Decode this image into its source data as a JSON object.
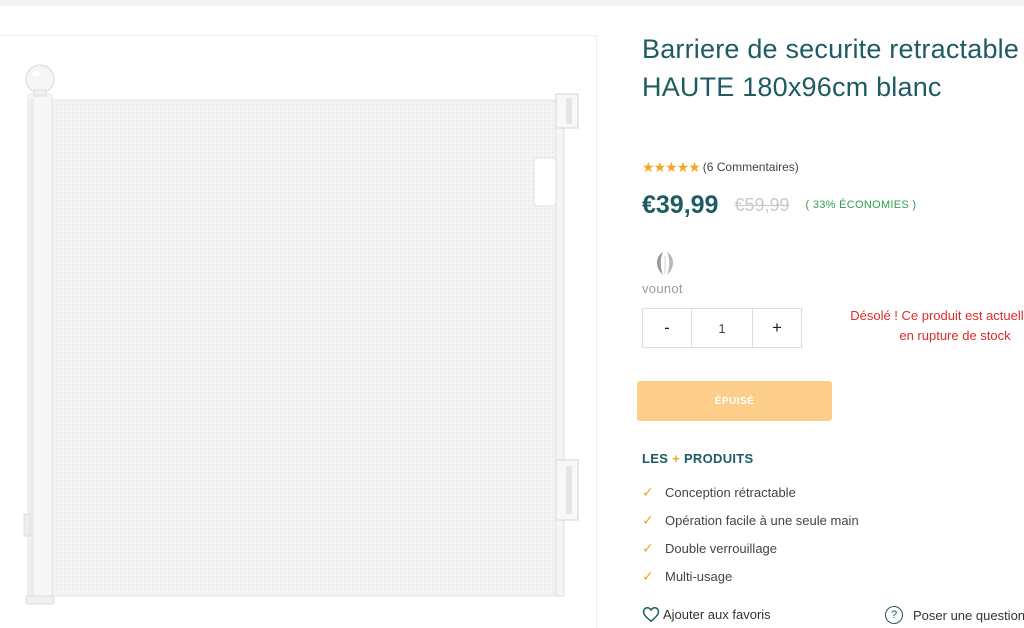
{
  "product": {
    "title": "Barriere de securite retractable HAUTE 180x96cm blanc",
    "image_alt": "Barrière de sécurité rétractable blanche",
    "rating": {
      "stars": 5,
      "reviews_label": "(6 Commentaires)"
    },
    "price": "€39,99",
    "old_price": "€59,99",
    "savings": "( 33% ÉCONOMIES )",
    "brand": "vounot",
    "quantity": {
      "decrement": "-",
      "value": "1",
      "increment": "+"
    },
    "stock_message": "Désolé ! Ce produit est actuellement en rupture de stock",
    "soldout_button": "ÉPUISÉ",
    "features_title": {
      "prefix": "LES",
      "plus": "+",
      "suffix": "PRODUITS"
    },
    "features": [
      "Conception rétractable",
      "Opération facile à une seule main",
      "Double verrouillage",
      "Multi-usage"
    ],
    "favorites_link": "Ajouter aux favoris",
    "question_link": "Poser une question"
  },
  "colors": {
    "title": "#1f5b63",
    "accent": "#f5a623",
    "savings": "#2d9e4c",
    "out_of_stock": "#e02b2b",
    "soldout_button": "#fdcd8a"
  },
  "icons": {
    "star": "star-icon",
    "check": "check-icon",
    "heart": "heart-icon",
    "question": "question-icon",
    "brand": "leaf-logo-icon"
  }
}
